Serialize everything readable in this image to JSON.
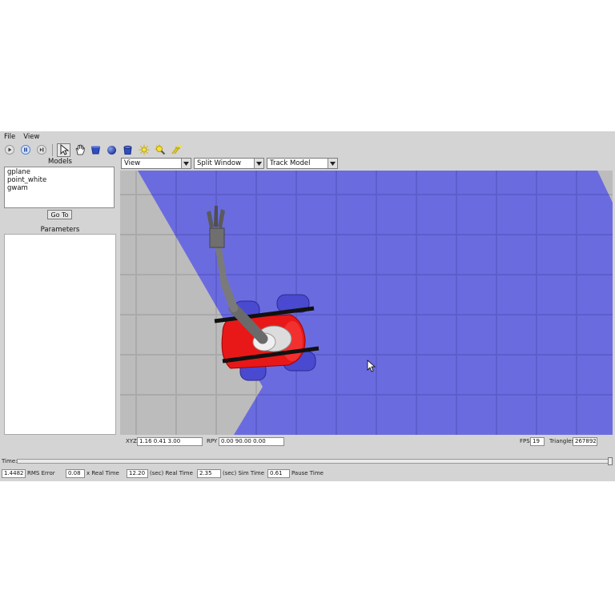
{
  "menubar": {
    "file": "File",
    "view": "View"
  },
  "toolbar": {
    "buttons": [
      "play-icon",
      "pause-icon",
      "step-icon",
      "select-arrow-icon",
      "hand-icon",
      "box-shape-icon",
      "sphere-shape-icon",
      "cylinder-shape-icon",
      "point-light-icon",
      "spot-light-icon",
      "directional-light-icon"
    ]
  },
  "left_panel": {
    "models_title": "Models",
    "models": [
      "gplane",
      "point_white",
      "gwam"
    ],
    "goto_label": "Go To",
    "parameters_title": "Parameters"
  },
  "view_bar": {
    "view_select": "View",
    "split_select": "Split Window",
    "track_select": "Track Model"
  },
  "status": {
    "xyz_label": "XYZ",
    "xyz_value": "1.16  0.41  3.00",
    "rpy_label": "RPY",
    "rpy_value": "0.00  90.00  0.00",
    "fps_label": "FPS",
    "fps_value": "19",
    "triangles_label": "Triangles",
    "triangles_value": "267892"
  },
  "time": {
    "label": "Time:",
    "slider_fraction": 1.0
  },
  "stats": {
    "rms_value": "1.4482",
    "rms_label": "RMS Error",
    "xreal_value": "0.08",
    "xreal_label": "x Real Time",
    "realtime_value": "12.20",
    "realtime_label": "(sec) Real Time",
    "simtime_value": "2.35",
    "simtime_label": "(sec) Sim Time",
    "pause_value": "0.61",
    "pause_label": "Pause Time"
  },
  "colors": {
    "ground_plane": "#6b6be0",
    "background_grid": "#bcbcbc",
    "robot_body": "#e81818",
    "wheels": "#4a4ad0",
    "arm": "#7a7a7a"
  }
}
